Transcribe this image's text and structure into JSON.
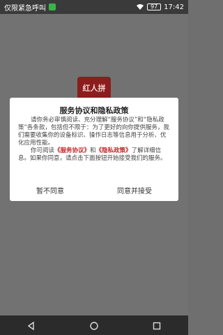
{
  "status_bar": {
    "carrier_text": "仅限紧急呼叫",
    "battery": "97",
    "time": "17:42"
  },
  "app": {
    "logo_text": "红人拼"
  },
  "dialog": {
    "title": "服务协议和隐私政策",
    "body_line1": "请你务必审慎阅读、充分理解“服务协议”和“隐私政策”各条款，包括但不限于：为了更好的向你提供服务，我们需要收集你的设备标识、操作日志等信息用于分析、优化应用性能。",
    "body_pre": "你可阅读",
    "link_service": "《服务协议》",
    "body_mid": "和",
    "link_privacy": "《隐私政策》",
    "body_post": "了解详细信息。如果你同意，请点击下面按钮开始接受我们的服务。",
    "disagree_label": "暂不同意",
    "agree_label": "同意并接受"
  },
  "colors": {
    "link": "#c62828",
    "overlay": "#727272"
  }
}
